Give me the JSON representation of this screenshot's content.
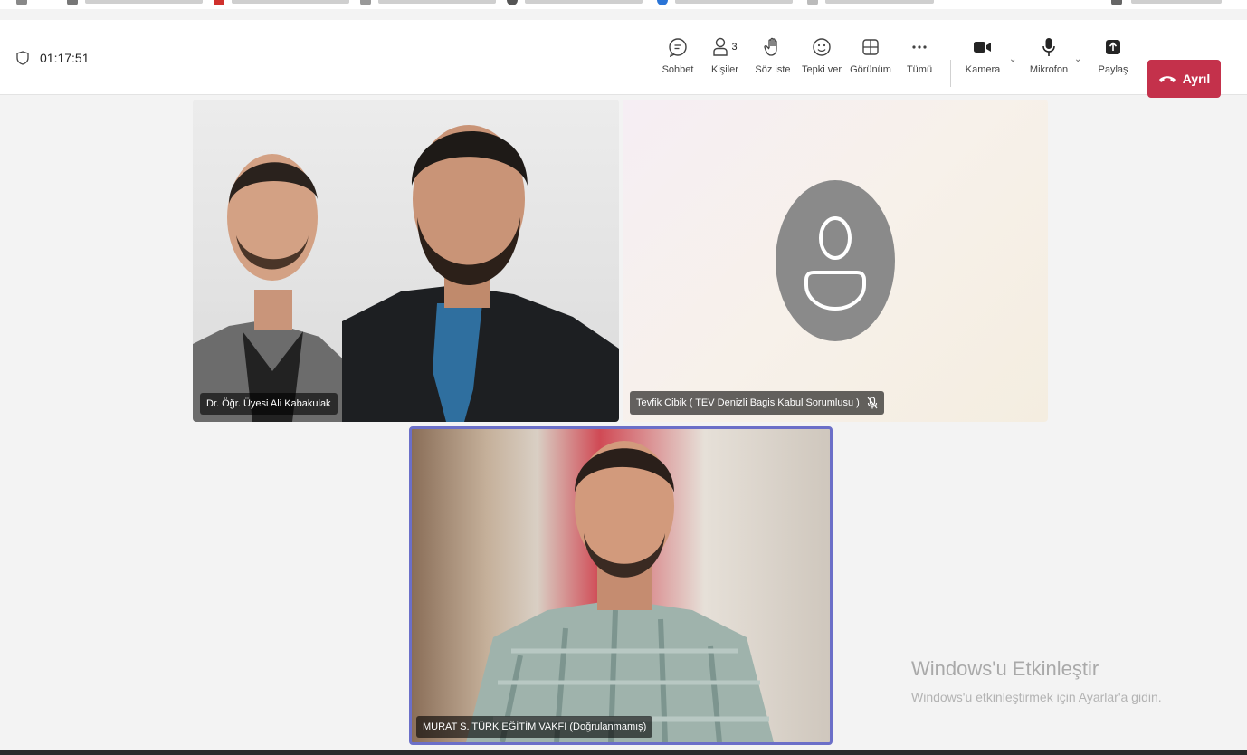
{
  "header": {
    "timer": "01:17:51"
  },
  "toolbar": {
    "chat_label": "Sohbet",
    "people_label": "Kişiler",
    "people_count": "3",
    "raise_hand_label": "Söz iste",
    "react_label": "Tepki ver",
    "view_label": "Görünüm",
    "more_label": "Tümü",
    "camera_label": "Kamera",
    "mic_label": "Mikrofon",
    "share_label": "Paylaş",
    "leave_label": "Ayrıl"
  },
  "participants": [
    {
      "name": "Dr. Öğr. Üyesi Ali Kabakulak",
      "video": true,
      "muted": false
    },
    {
      "name": "Tevfik Cibik ( TEV Denizli Bagis Kabul Sorumlusu )",
      "video": false,
      "muted": true
    },
    {
      "name": "MURAT S. TÜRK EĞİTİM VAKFI (Doğrulanmamış)",
      "video": true,
      "muted": false,
      "active_speaker": true
    }
  ],
  "watermark": {
    "title": "Windows'u Etkinleştir",
    "subtitle": "Windows'u etkinleştirmek için Ayarlar'a gidin."
  },
  "colors": {
    "leave_button": "#c4314b",
    "active_speaker_border": "#6b6fc8",
    "avatar_gray": "#8a8a8a"
  }
}
